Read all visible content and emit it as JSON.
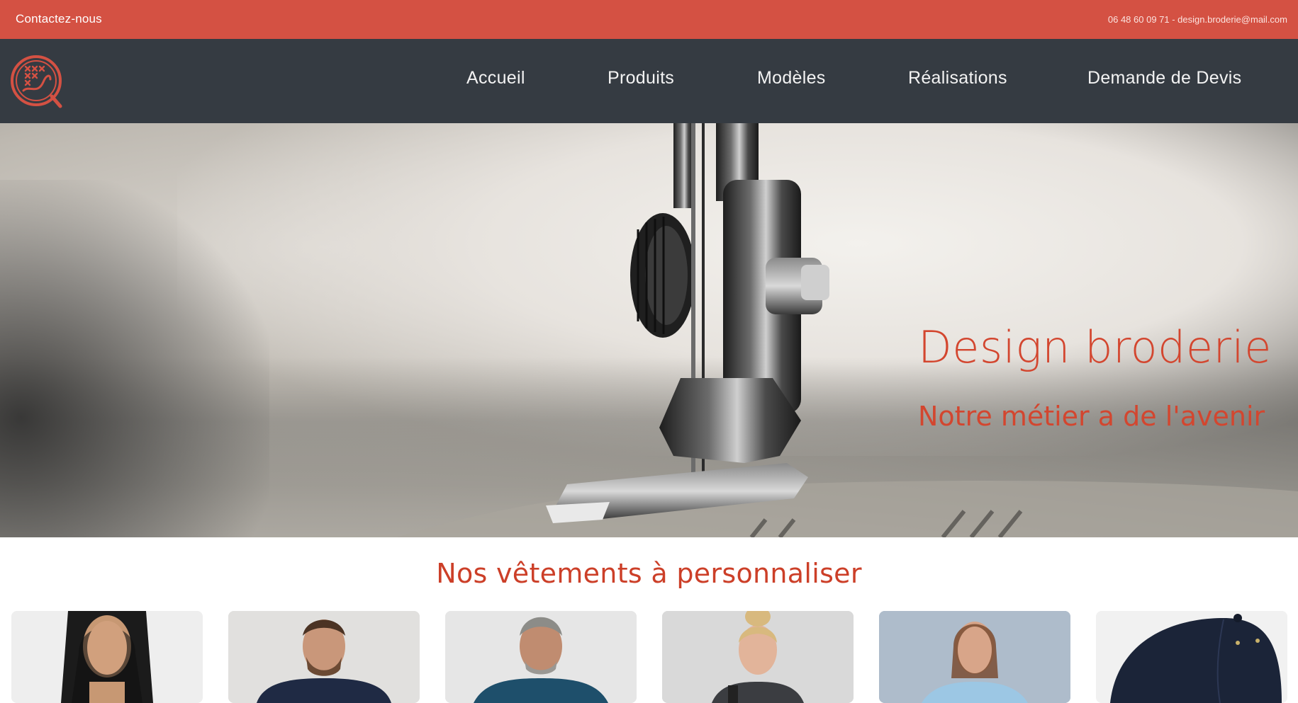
{
  "topbar": {
    "contact_label": "Contactez-nous",
    "contact_info": "06 48 60 09 71 - design.broderie@mail.com"
  },
  "brand": {
    "accent": "#d45143",
    "nav_bg": "#353b42",
    "title_color": "#d3462f"
  },
  "nav": {
    "items": [
      {
        "label": "Accueil"
      },
      {
        "label": "Produits"
      },
      {
        "label": "Modèles"
      },
      {
        "label": "Réalisations"
      },
      {
        "label": "Demande de Devis"
      }
    ]
  },
  "hero": {
    "title": "Design broderie",
    "subtitle": "Notre métier a de l'avenir"
  },
  "products": {
    "title": "Nos vêtements à personnaliser",
    "cards": [
      {
        "name": "woman-black-top"
      },
      {
        "name": "man-navy-sweater"
      },
      {
        "name": "man-teal-shirt"
      },
      {
        "name": "woman-grey-jacket"
      },
      {
        "name": "woman-light-blue-shirt"
      },
      {
        "name": "navy-cap"
      }
    ]
  }
}
